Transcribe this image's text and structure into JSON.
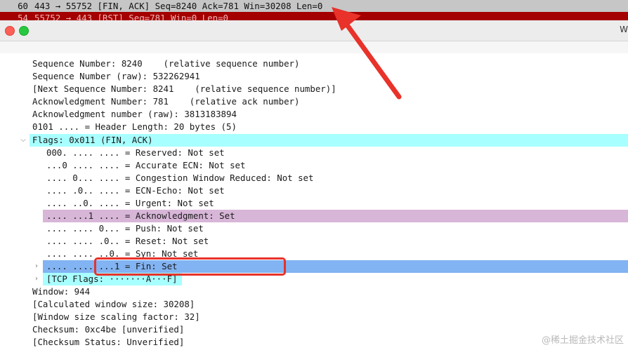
{
  "packet_list": [
    {
      "no": "60",
      "info": "443 → 55752 [FIN, ACK] Seq=8240 Ack=781 Win=30208 Len=0"
    },
    {
      "no": "54",
      "info": "55752 → 443 [RST] Seq=781 Win=0 Len=0"
    }
  ],
  "window": {
    "title_fragment": "W"
  },
  "details": {
    "seq": "Sequence Number: 8240    (relative sequence number)",
    "seq_raw": "Sequence Number (raw): 532262941",
    "next_seq": "[Next Sequence Number: 8241    (relative sequence number)]",
    "ack": "Acknowledgment Number: 781    (relative ack number)",
    "ack_raw": "Acknowledgment number (raw): 3813183894",
    "header_len": "0101 .... = Header Length: 20 bytes (5)",
    "flags": "Flags: 0x011 (FIN, ACK)",
    "flag_items": [
      "000. .... .... = Reserved: Not set",
      "...0 .... .... = Accurate ECN: Not set",
      ".... 0... .... = Congestion Window Reduced: Not set",
      ".... .0.. .... = ECN-Echo: Not set",
      ".... ..0. .... = Urgent: Not set",
      ".... ...1 .... = Acknowledgment: Set",
      ".... .... 0... = Push: Not set",
      ".... .... .0.. = Reset: Not set",
      ".... .... ..0. = Syn: Not set",
      ".... .... ...1 = Fin: Set"
    ],
    "tcp_flags": "[TCP Flags: ·······A···F]",
    "window": "Window: 944",
    "calc_window": "[Calculated window size: 30208]",
    "scaling": "[Window size scaling factor: 32]",
    "checksum": "Checksum: 0xc4be [unverified]",
    "checksum_status": "[Checksum Status: Unverified]"
  },
  "watermark": "@稀土掘金技术社区",
  "colors": {
    "highlight_cyan": "#a8ffff",
    "highlight_purple": "#d8b6d8",
    "highlight_blue": "#82b3f2",
    "annotation_red": "#e8322a"
  }
}
